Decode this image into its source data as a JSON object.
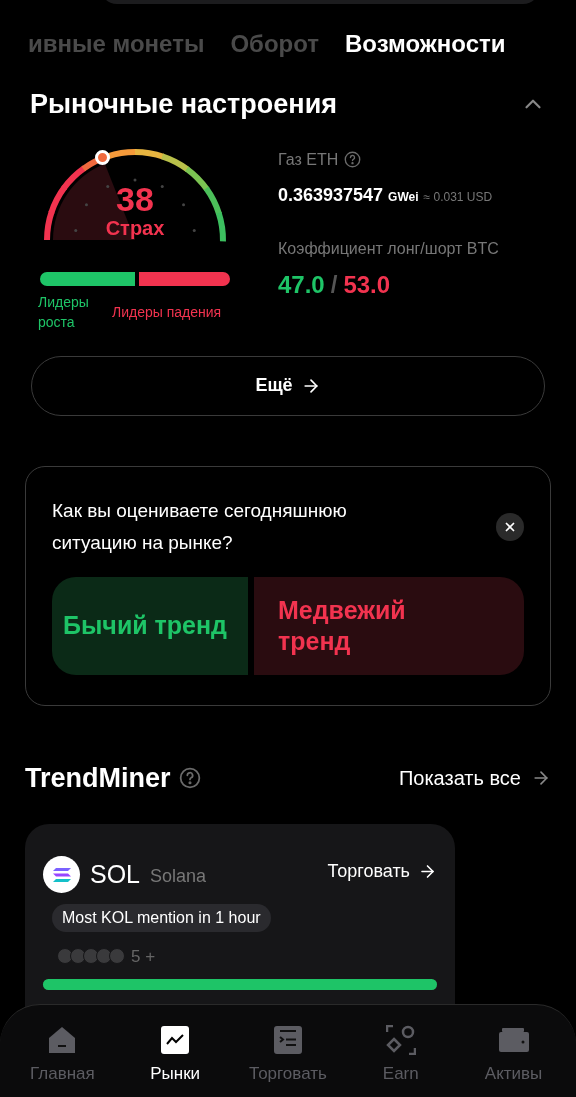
{
  "tabs": [
    {
      "label": "ивные монеты",
      "selected": false
    },
    {
      "label": "Оборот",
      "selected": false
    },
    {
      "label": "Возможности",
      "selected": true
    }
  ],
  "sentiment": {
    "title": "Рыночные настроения",
    "expanded": true,
    "gauge": {
      "value": "38",
      "label": "Страх"
    },
    "gainers_label": "Лидеры роста",
    "losers_label": "Лидеры падения",
    "gas": {
      "label": "Газ ETH",
      "value": "0.363937547",
      "unit": "GWei",
      "usd": "≈ 0.031 USD"
    },
    "ratio": {
      "label": "Коэффициент лонг/шорт BTC",
      "long": "47.0",
      "separator": "/",
      "short": "53.0"
    },
    "more_button": "Ещё"
  },
  "poll": {
    "question": "Как вы оцениваете сегодняшнюю ситуацию на рынке?",
    "options": [
      {
        "label": "Бычий тренд",
        "kind": "bull"
      },
      {
        "label": "Медвежий тренд",
        "kind": "bear"
      }
    ]
  },
  "trendminer": {
    "title": "TrendMiner",
    "show_all": "Показать все",
    "card": {
      "symbol": "SOL",
      "name": "Solana",
      "trade": "Торговать",
      "tag": "Most KOL mention in 1 hour",
      "count": "5 +",
      "level": 1
    }
  },
  "nav": [
    {
      "label": "Главная",
      "kind": "home",
      "selected": false
    },
    {
      "label": "Рынки",
      "kind": "chart",
      "selected": true
    },
    {
      "label": "Торговать",
      "kind": "trade",
      "selected": false
    },
    {
      "label": "Earn",
      "kind": "earn",
      "selected": false
    },
    {
      "label": "Активы",
      "kind": "wallet",
      "selected": false
    }
  ]
}
